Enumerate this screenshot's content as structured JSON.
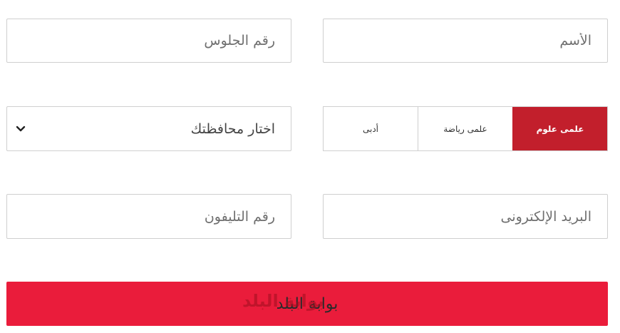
{
  "form": {
    "name_placeholder": "الأسم",
    "seat_placeholder": "رقم الجلوس",
    "track_options": [
      "علمى علوم",
      "علمى رياضة",
      "أدبى"
    ],
    "active_track": "علمى علوم",
    "governorate_placeholder": "اختار محافظتك",
    "email_placeholder": "البريد الإلكترونى",
    "phone_placeholder": "رقم التليفون",
    "submit_label": "بوابة البلد"
  },
  "branding": {
    "watermark": "بوابة البلد"
  },
  "colors": {
    "active_tab": "#c21f2c",
    "submit_bg": "#ea1c3b",
    "border": "#cfcfcf"
  }
}
